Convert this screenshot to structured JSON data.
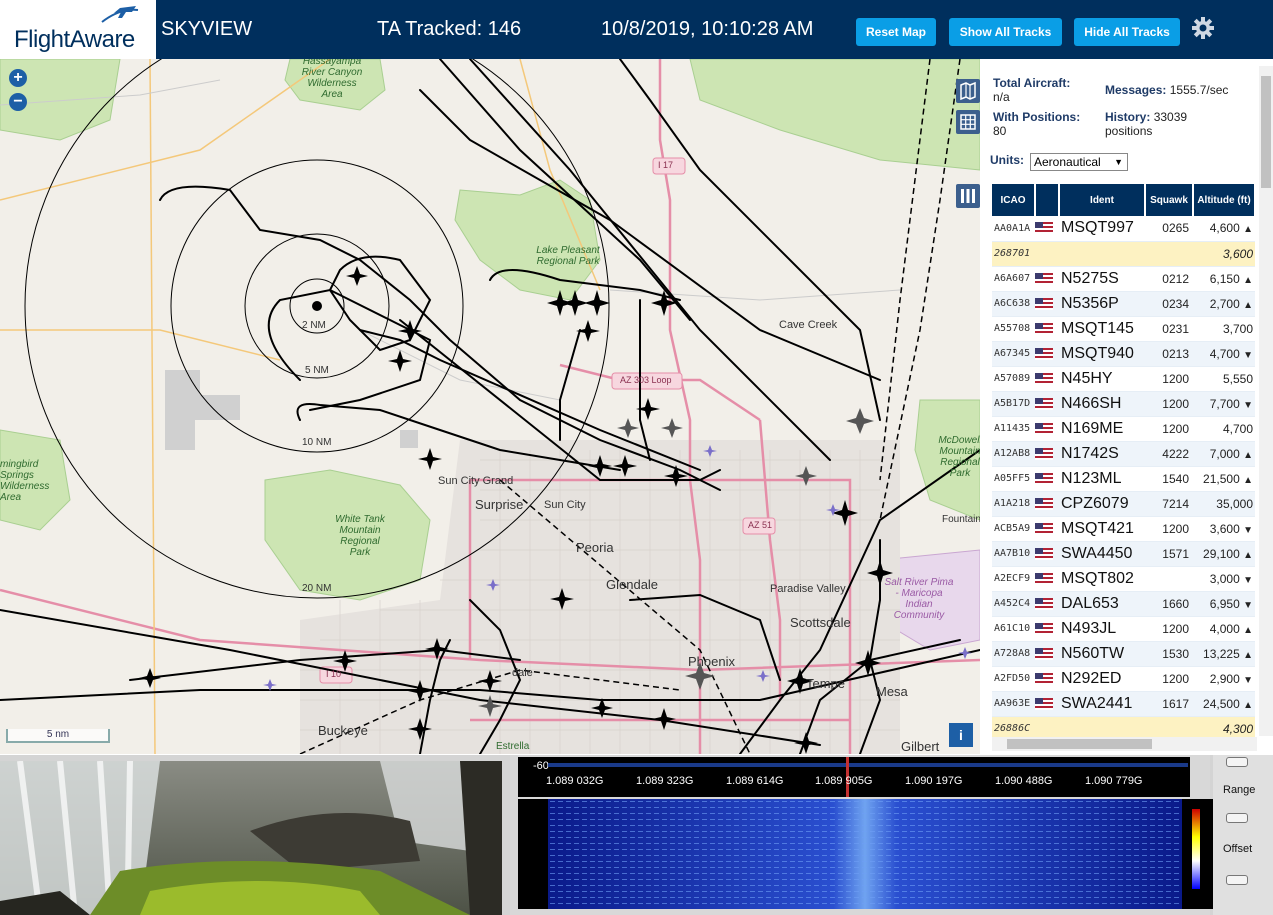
{
  "header": {
    "logo_text": "FlightAware",
    "title": "SKYVIEW",
    "tracked_label": "TA Tracked: 146",
    "datetime": "10/8/2019, 10:10:28 AM",
    "buttons": {
      "reset": "Reset Map",
      "show_all": "Show All Tracks",
      "hide_all": "Hide All Tracks"
    },
    "settings_icon": "gear-icon"
  },
  "map": {
    "zoom_in": "+",
    "zoom_out": "−",
    "scale_label": "5 nm",
    "info_button": "i",
    "range_rings": [
      "2 NM",
      "5 NM",
      "10 NM",
      "20 NM"
    ],
    "places": [
      {
        "id": "sun-city-grand",
        "label": "Sun City Grand"
      },
      {
        "id": "surprise",
        "label": "Surprise"
      },
      {
        "id": "sun-city",
        "label": "Sun City"
      },
      {
        "id": "peoria",
        "label": "Peoria"
      },
      {
        "id": "glendale",
        "label": "Glendale"
      },
      {
        "id": "phoenix",
        "label": "Phoenix"
      },
      {
        "id": "scottsdale",
        "label": "Scottsdale"
      },
      {
        "id": "paradise-valley",
        "label": "Paradise Valley"
      },
      {
        "id": "tempe",
        "label": "Tempe"
      },
      {
        "id": "mesa",
        "label": "Mesa"
      },
      {
        "id": "gilbert",
        "label": "Gilbert"
      },
      {
        "id": "buckeye",
        "label": "Buckeye"
      },
      {
        "id": "cave-creek",
        "label": "Cave Creek"
      },
      {
        "id": "avondale",
        "label": "dale"
      },
      {
        "id": "estrella",
        "label": "Estrella"
      },
      {
        "id": "fountain",
        "label": "Fountain"
      }
    ],
    "parks": [
      {
        "id": "hassayampa",
        "label": "Hassayampa River Canyon Wilderness Area"
      },
      {
        "id": "lake-pleasant",
        "label": "Lake Pleasant Regional Park"
      },
      {
        "id": "white-tank",
        "label": "White Tank Mountain Regional Park"
      },
      {
        "id": "mcdowell",
        "label": "McDowell Mountain Regional Park"
      },
      {
        "id": "hummingbird",
        "label": "mingbird Springs Wilderness Area"
      },
      {
        "id": "salt-river",
        "label": "Salt River Pima - Maricopa Indian Community"
      }
    ],
    "shields": {
      "i17": "I 17",
      "az303": "AZ 303 Loop",
      "az51": "AZ 51",
      "i10": "I 10"
    },
    "controls": {
      "map_icon": "map-icon",
      "grid_icon": "grid-icon",
      "columns_icon": "columns-icon"
    }
  },
  "panel": {
    "total_aircraft_label": "Total Aircraft:",
    "total_aircraft_value": "n/a",
    "with_positions_label": "With Positions:",
    "with_positions_value": "80",
    "messages_label": "Messages:",
    "messages_value": "1555.7/sec",
    "history_label": "History:",
    "history_value": "33039 positions",
    "units_label": "Units:",
    "units_value": "Aeronautical",
    "columns": [
      "ICAO",
      "",
      "Ident",
      "Squawk",
      "Altitude (ft)"
    ],
    "rows": [
      {
        "icao": "AA0A1A",
        "flag": true,
        "ident": "MSQT997",
        "squawk": "0265",
        "alt": "4,600",
        "trend": "▲",
        "mlat": false
      },
      {
        "icao": "268701",
        "flag": false,
        "ident": "",
        "squawk": "",
        "alt": "3,600",
        "trend": "",
        "mlat": true
      },
      {
        "icao": "A6A607",
        "flag": true,
        "ident": "N5275S",
        "squawk": "0212",
        "alt": "6,150",
        "trend": "▲",
        "mlat": false
      },
      {
        "icao": "A6C638",
        "flag": true,
        "ident": "N5356P",
        "squawk": "0234",
        "alt": "2,700",
        "trend": "▲",
        "mlat": false
      },
      {
        "icao": "A55708",
        "flag": true,
        "ident": "MSQT145",
        "squawk": "0231",
        "alt": "3,700",
        "trend": "",
        "mlat": false
      },
      {
        "icao": "A67345",
        "flag": true,
        "ident": "MSQT940",
        "squawk": "0213",
        "alt": "4,700",
        "trend": "▼",
        "mlat": false
      },
      {
        "icao": "A57089",
        "flag": true,
        "ident": "N45HY",
        "squawk": "1200",
        "alt": "5,550",
        "trend": "",
        "mlat": false
      },
      {
        "icao": "A5B17D",
        "flag": true,
        "ident": "N466SH",
        "squawk": "1200",
        "alt": "7,700",
        "trend": "▼",
        "mlat": false
      },
      {
        "icao": "A11435",
        "flag": true,
        "ident": "N169ME",
        "squawk": "1200",
        "alt": "4,700",
        "trend": "",
        "mlat": false
      },
      {
        "icao": "A12AB8",
        "flag": true,
        "ident": "N1742S",
        "squawk": "4222",
        "alt": "7,000",
        "trend": "▲",
        "mlat": false
      },
      {
        "icao": "A05FF5",
        "flag": true,
        "ident": "N123ML",
        "squawk": "1540",
        "alt": "21,500",
        "trend": "▲",
        "mlat": false
      },
      {
        "icao": "A1A218",
        "flag": true,
        "ident": "CPZ6079",
        "squawk": "7214",
        "alt": "35,000",
        "trend": "",
        "mlat": false
      },
      {
        "icao": "ACB5A9",
        "flag": true,
        "ident": "MSQT421",
        "squawk": "1200",
        "alt": "3,600",
        "trend": "▼",
        "mlat": false
      },
      {
        "icao": "AA7B10",
        "flag": true,
        "ident": "SWA4450",
        "squawk": "1571",
        "alt": "29,100",
        "trend": "▲",
        "mlat": false
      },
      {
        "icao": "A2ECF9",
        "flag": true,
        "ident": "MSQT802",
        "squawk": "",
        "alt": "3,000",
        "trend": "▼",
        "mlat": false
      },
      {
        "icao": "A452C4",
        "flag": true,
        "ident": "DAL653",
        "squawk": "1660",
        "alt": "6,950",
        "trend": "▼",
        "mlat": false
      },
      {
        "icao": "A61C10",
        "flag": true,
        "ident": "N493JL",
        "squawk": "1200",
        "alt": "4,000",
        "trend": "▲",
        "mlat": false
      },
      {
        "icao": "A728A8",
        "flag": true,
        "ident": "N560TW",
        "squawk": "1530",
        "alt": "13,225",
        "trend": "▲",
        "mlat": false
      },
      {
        "icao": "A2FD50",
        "flag": true,
        "ident": "N292ED",
        "squawk": "1200",
        "alt": "2,900",
        "trend": "▼",
        "mlat": false
      },
      {
        "icao": "AA963E",
        "flag": true,
        "ident": "SWA2441",
        "squawk": "1617",
        "alt": "24,500",
        "trend": "▲",
        "mlat": false
      },
      {
        "icao": "26886C",
        "flag": false,
        "ident": "",
        "squawk": "",
        "alt": "4,300",
        "trend": "",
        "mlat": true
      }
    ]
  },
  "spectrum": {
    "db_label": "-60",
    "freq_ticks": [
      "1.089 032G",
      "1.089 323G",
      "1.089 614G",
      "1.089 905G",
      "1.090 197G",
      "1.090 488G",
      "1.090 779G"
    ],
    "range_label": "Range",
    "offset_label": "Offset"
  },
  "colors": {
    "header": "#002f5d",
    "button": "#0a9ee6",
    "track": "#000000",
    "mlat_row": "#fdf2c2"
  }
}
